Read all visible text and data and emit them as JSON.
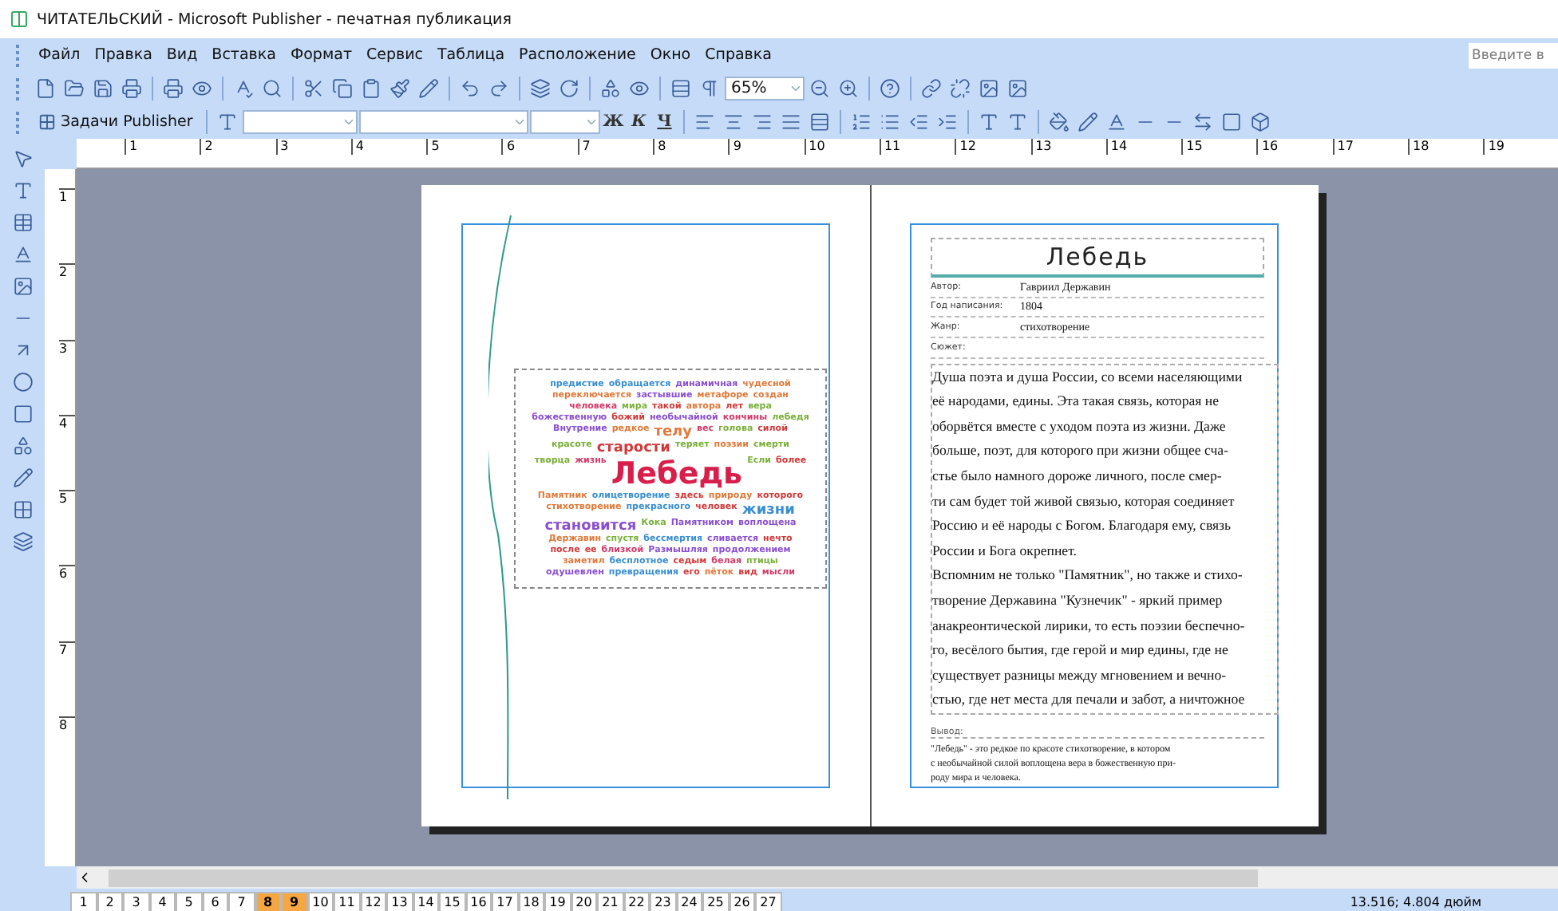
{
  "window": {
    "title": "ЧИТАТЕЛЬСКИЙ - Microsoft Publisher - печатная публикация"
  },
  "menu": [
    "Файл",
    "Правка",
    "Вид",
    "Вставка",
    "Формат",
    "Сервис",
    "Таблица",
    "Расположение",
    "Окно",
    "Справка"
  ],
  "help_search": {
    "placeholder": "Введите в"
  },
  "zoom": {
    "value": "65%"
  },
  "task_pane": {
    "label": "Задачи Publisher"
  },
  "format_buttons": [
    "Ж",
    "К",
    "Ч"
  ],
  "ruler": {
    "horizontal": [
      "1",
      "2",
      "3",
      "4",
      "5",
      "6",
      "7",
      "8",
      "9",
      "10",
      "11",
      "12",
      "13",
      "14",
      "15",
      "16",
      "17",
      "18",
      "19"
    ],
    "vertical": [
      "1",
      "2",
      "3",
      "4",
      "5",
      "6",
      "7",
      "8"
    ]
  },
  "word_cloud": [
    {
      "text": "предистие",
      "color": "#3a8fd0",
      "kind": "small"
    },
    {
      "text": "обращается",
      "color": "#3a8fd0",
      "kind": "small"
    },
    {
      "text": "динамичная",
      "color": "#8a4fd0",
      "kind": "small"
    },
    {
      "text": "чудесной",
      "color": "#e07a3a",
      "kind": "small"
    },
    {
      "text": "переключается",
      "color": "#e07a3a",
      "kind": "small"
    },
    {
      "text": "застывшие",
      "color": "#8a4fd0",
      "kind": "small"
    },
    {
      "text": "метафоре",
      "color": "#e07a3a",
      "kind": "small"
    },
    {
      "text": "создан",
      "color": "#e07a3a",
      "kind": "small"
    },
    {
      "text": "человека",
      "color": "#d03a6a",
      "kind": "small"
    },
    {
      "text": "мира",
      "color": "#7ab03a",
      "kind": "small"
    },
    {
      "text": "такой",
      "color": "#d03a3a",
      "kind": "small"
    },
    {
      "text": "автора",
      "color": "#e07a3a",
      "kind": "small"
    },
    {
      "text": "лет",
      "color": "#d03a3a",
      "kind": "small"
    },
    {
      "text": "вера",
      "color": "#7ab03a",
      "kind": "small"
    },
    {
      "text": "божественную",
      "color": "#8a4fd0",
      "kind": "small"
    },
    {
      "text": "божий",
      "color": "#d03a3a",
      "kind": "small"
    },
    {
      "text": "необычайной",
      "color": "#8a4fd0",
      "kind": "small"
    },
    {
      "text": "кончины",
      "color": "#d03a6a",
      "kind": "small"
    },
    {
      "text": "лебедя",
      "color": "#7ab03a",
      "kind": "small"
    },
    {
      "text": "Внутрение",
      "color": "#8a4fd0",
      "kind": "small"
    },
    {
      "text": "редкое",
      "color": "#e07a3a",
      "kind": "small"
    },
    {
      "text": "телу",
      "color": "#e07a3a",
      "kind": "medium"
    },
    {
      "text": "вес",
      "color": "#d03a6a",
      "kind": "small"
    },
    {
      "text": "голова",
      "color": "#7ab03a",
      "kind": "small"
    },
    {
      "text": "силой",
      "color": "#d03a3a",
      "kind": "small"
    },
    {
      "text": "красоте",
      "color": "#7ab03a",
      "kind": "small"
    },
    {
      "text": "старости",
      "color": "#d03a3a",
      "kind": "medium"
    },
    {
      "text": "теряет",
      "color": "#7ab03a",
      "kind": "small"
    },
    {
      "text": "поэзии",
      "color": "#e07a3a",
      "kind": "small"
    },
    {
      "text": "смерти",
      "color": "#7ab03a",
      "kind": "small"
    },
    {
      "text": "творца",
      "color": "#7ab03a",
      "kind": "small"
    },
    {
      "text": "жизнь",
      "color": "#d03a6a",
      "kind": "small"
    },
    {
      "text": "Лебедь",
      "color": "#d81e4a",
      "kind": "large"
    },
    {
      "text": "Если",
      "color": "#7ab03a",
      "kind": "small"
    },
    {
      "text": "более",
      "color": "#d03a3a",
      "kind": "small"
    },
    {
      "text": "Памятник",
      "color": "#e07a3a",
      "kind": "small"
    },
    {
      "text": "олицетворение",
      "color": "#3a8fd0",
      "kind": "small"
    },
    {
      "text": "здесь",
      "color": "#d03a3a",
      "kind": "small"
    },
    {
      "text": "природу",
      "color": "#e07a3a",
      "kind": "small"
    },
    {
      "text": "которого",
      "color": "#d03a3a",
      "kind": "small"
    },
    {
      "text": "стихотворение",
      "color": "#e07a3a",
      "kind": "small"
    },
    {
      "text": "прекрасного",
      "color": "#3a8fd0",
      "kind": "small"
    },
    {
      "text": "человек",
      "color": "#d03a3a",
      "kind": "small"
    },
    {
      "text": "жизни",
      "color": "#3a8fd0",
      "kind": "medium"
    },
    {
      "text": "становится",
      "color": "#8a4fd0",
      "kind": "medium"
    },
    {
      "text": "Кока",
      "color": "#7ab03a",
      "kind": "small"
    },
    {
      "text": "Памятником",
      "color": "#8a4fd0",
      "kind": "small"
    },
    {
      "text": "воплощена",
      "color": "#8a4fd0",
      "kind": "small"
    },
    {
      "text": "Державин",
      "color": "#e07a3a",
      "kind": "small"
    },
    {
      "text": "спустя",
      "color": "#7ab03a",
      "kind": "small"
    },
    {
      "text": "бессмертия",
      "color": "#3a8fd0",
      "kind": "small"
    },
    {
      "text": "сливается",
      "color": "#8a4fd0",
      "kind": "small"
    },
    {
      "text": "нечто",
      "color": "#d03a3a",
      "kind": "small"
    },
    {
      "text": "после",
      "color": "#d03a3a",
      "kind": "small"
    },
    {
      "text": "ее",
      "color": "#d03a3a",
      "kind": "small"
    },
    {
      "text": "близкой",
      "color": "#d03a6a",
      "kind": "small"
    },
    {
      "text": "Размышляя",
      "color": "#8a4fd0",
      "kind": "small"
    },
    {
      "text": "продолжением",
      "color": "#8a4fd0",
      "kind": "small"
    },
    {
      "text": "заметил",
      "color": "#e07a3a",
      "kind": "small"
    },
    {
      "text": "бесплотное",
      "color": "#3a8fd0",
      "kind": "small"
    },
    {
      "text": "седым",
      "color": "#d03a3a",
      "kind": "small"
    },
    {
      "text": "белая",
      "color": "#d03a6a",
      "kind": "small"
    },
    {
      "text": "птицы",
      "color": "#7ab03a",
      "kind": "small"
    },
    {
      "text": "одушевлен",
      "color": "#8a4fd0",
      "kind": "small"
    },
    {
      "text": "превращения",
      "color": "#3a8fd0",
      "kind": "small"
    },
    {
      "text": "его",
      "color": "#d03a3a",
      "kind": "small"
    },
    {
      "text": "пёток",
      "color": "#e07a3a",
      "kind": "small"
    },
    {
      "text": "вид",
      "color": "#d03a3a",
      "kind": "small"
    },
    {
      "text": "мысли",
      "color": "#d03a6a",
      "kind": "small"
    }
  ],
  "document": {
    "title": "Лебедь",
    "fields": [
      {
        "label": "Автор:",
        "value": "Гавриил Державин"
      },
      {
        "label": "Год написания:",
        "value": "1804"
      },
      {
        "label": "Жанр:",
        "value": "стихотворение"
      },
      {
        "label": "Сюжет:"
      }
    ],
    "body_lines": [
      "Душа поэта и душа России, со всеми населяющими",
      "её народами, едины. Эта такая связь, которая не",
      "оборвётся вместе с уходом поэта из жизни. Даже",
      "больше, поэт, для которого при жизни общее сча-",
      "стье было намного дороже личного, после смер-",
      "ти  сам будет той живой связью, которая соединяет",
      "Россию и её народы с Богом. Благодаря ему, связь",
      "России и Бога окрепнет.",
      "Вспомним не только \"Памятник\", но также и стихо-",
      "творение Державина \"Кузнечик\" - яркий пример",
      "анакреонтической лирики, то есть поэзии беспечно-",
      "го, весёлого бытия, где герой и мир едины, где не",
      "существует разницы между мгновением и вечно-",
      "стью, где нет места для печали и забот, а ничтожное"
    ],
    "conclusion_label": "Вывод:",
    "conclusion_lines": [
      "\"Лебедь\" - это редкое по красоте стихотворение, в котором",
      "с необычайной силой воплощена вера в божественную при-",
      "роду мира и человека."
    ]
  },
  "page_tabs": [
    {
      "label": "1",
      "selected": false
    },
    {
      "label": "2",
      "selected": false
    },
    {
      "label": "3",
      "selected": false
    },
    {
      "label": "4",
      "selected": false
    },
    {
      "label": "5",
      "selected": false
    },
    {
      "label": "6",
      "selected": false
    },
    {
      "label": "7",
      "selected": false
    },
    {
      "label": "8",
      "selected": true
    },
    {
      "label": "9",
      "selected": true
    },
    {
      "label": "10",
      "selected": false
    },
    {
      "label": "11",
      "selected": false
    },
    {
      "label": "12",
      "selected": false
    },
    {
      "label": "13",
      "selected": false
    },
    {
      "label": "14",
      "selected": false
    },
    {
      "label": "15",
      "selected": false
    },
    {
      "label": "16",
      "selected": false
    },
    {
      "label": "17",
      "selected": false
    },
    {
      "label": "18",
      "selected": false
    },
    {
      "label": "19",
      "selected": false
    },
    {
      "label": "20",
      "selected": false
    },
    {
      "label": "21",
      "selected": false
    },
    {
      "label": "22",
      "selected": false
    },
    {
      "label": "23",
      "selected": false
    },
    {
      "label": "24",
      "selected": false
    },
    {
      "label": "25",
      "selected": false
    },
    {
      "label": "26",
      "selected": false
    },
    {
      "label": "27",
      "selected": false
    }
  ],
  "status_bar": {
    "position": "13.516; 4.804 дюйм"
  }
}
